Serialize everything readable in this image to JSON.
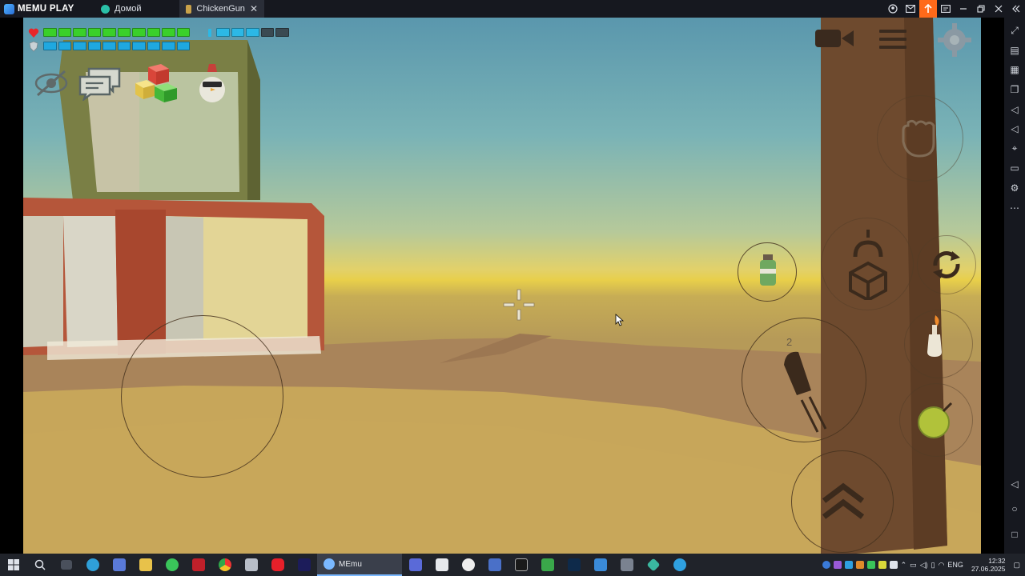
{
  "app": {
    "brand": "MEMU PLAY",
    "tabs": [
      {
        "label": "Домой",
        "active": false
      },
      {
        "label": "ChickenGun",
        "active": true
      }
    ],
    "title_buttons": [
      "user-icon",
      "mail-icon",
      "upload-icon",
      "menu-icon",
      "minimize-icon",
      "restore-icon",
      "close-icon",
      "collapse-icon"
    ]
  },
  "sidebar": {
    "buttons": [
      "expand-icon",
      "keyboard-icon",
      "apk-icon",
      "multi-window-icon",
      "volume-up-icon",
      "volume-down-icon",
      "location-icon",
      "folder-icon",
      "settings-icon",
      "more-icon"
    ],
    "nav": [
      "back-icon",
      "home-icon",
      "recent-icon"
    ]
  },
  "game": {
    "health_fraction": 1.0,
    "armor_fraction": 1.0,
    "ammo_fraction": 0.6,
    "jump_count": "2",
    "colors": {
      "health": "#3ad02a",
      "armor": "#1fa8e0",
      "ammo": "#2cb8e6",
      "sky": "#5a97ad",
      "sand": "#c8a95a"
    },
    "icons": [
      "heart-icon",
      "shield-icon",
      "hide-icon",
      "chat-icon",
      "blocks-icon",
      "chicken-icon",
      "camera-icon",
      "menu-icon",
      "gear-icon",
      "grab-icon",
      "grenade-icon",
      "build-icon",
      "reload-icon",
      "molotov-icon",
      "fire-icon",
      "bomb-icon",
      "jump-icon",
      "crosshair-icon"
    ]
  },
  "taskbar": {
    "active_app": "MEmu",
    "tray_lang": "ENG",
    "time": "12:32",
    "date": "27.06.2025"
  }
}
